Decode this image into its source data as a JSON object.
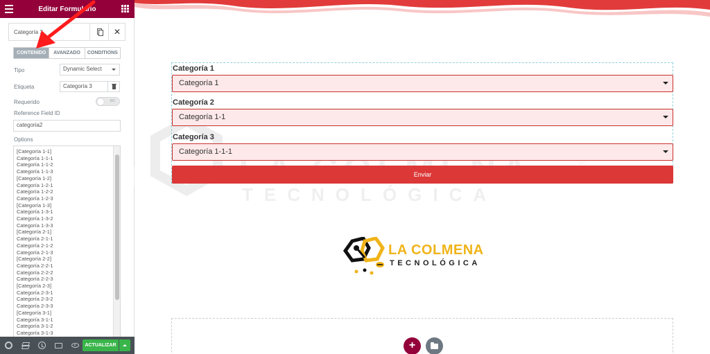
{
  "panel": {
    "title": "Editar Formulario",
    "field_name": "Categoría 3",
    "tabs": [
      {
        "label": "CONTENIDO",
        "active": true
      },
      {
        "label": "AVANZADO",
        "active": false
      },
      {
        "label": "CONDITIONS",
        "active": false
      }
    ],
    "tipo_label": "Tipo",
    "tipo_value": "Dynamic Select",
    "etiqueta_label": "Etiqueta",
    "etiqueta_value": "Categoría 3",
    "requerido_label": "Requerido",
    "requerido_state": "NO",
    "reference_label": "Reference Field ID",
    "reference_value": "categoria2",
    "options_label": "Options",
    "options": [
      "[Categoría 1-1]",
      "Categoría 1-1-1",
      "Categoría 1-1-2",
      "Categoría 1-1-3",
      "[Categoría 1-2]",
      "Categoría 1-2-1",
      "Categoría 1-2-2",
      "Categoría 1-2-3",
      "[Categoría 1-3]",
      "Categoría 1-3-1",
      "Categoría 1-3-2",
      "Categoría 1-3-3",
      "[Categoría 2-1]",
      "Categoría 2-1-1",
      "Categoría 2-1-2",
      "Categoría 2-1-3",
      "[Categoría 2-2]",
      "Categoría 2-2-1",
      "Categoría 2-2-2",
      "Categoría 2-2-3",
      "[Categoría 2-3]",
      "Categoría 2-3-1",
      "Categoría 2-3-2",
      "Categoría 2-3-3",
      "[Categoría 3-1]",
      "Categoría 3-1-1",
      "Categoría 3-1-2",
      "Categoría 3-1-3"
    ],
    "update_label": "ACTUALIZAR"
  },
  "form": {
    "fields": [
      {
        "label": "Categoría 1",
        "value": "Categoría 1"
      },
      {
        "label": "Categoría 2",
        "value": "Categoría 1-1"
      },
      {
        "label": "Categoría 3",
        "value": "Categoría 1-1-1"
      }
    ],
    "submit_label": "Enviar"
  },
  "logo": {
    "name": "LA COLMENA",
    "sub": "TECNOLÓGICA"
  },
  "watermark": {
    "line1": "LA COLMENA",
    "line2": "TECNOLÓGICA",
    "mark": "®"
  },
  "colors": {
    "header_bg": "#93003a",
    "accent_red": "#dc3838",
    "field_border": "#c9302c",
    "update_green": "#39b54a",
    "brand_yellow": "#f0b41a"
  },
  "icons": {
    "menu": "hamburger-icon",
    "widgets": "grid-icon",
    "duplicate": "copy-icon",
    "close": "close-icon",
    "delete": "trash-icon",
    "footer": [
      "gear-icon",
      "layers-icon",
      "history-icon",
      "responsive-icon",
      "eye-icon"
    ],
    "add": "plus-icon",
    "template": "folder-icon",
    "collapse": "chevron-left-icon"
  }
}
